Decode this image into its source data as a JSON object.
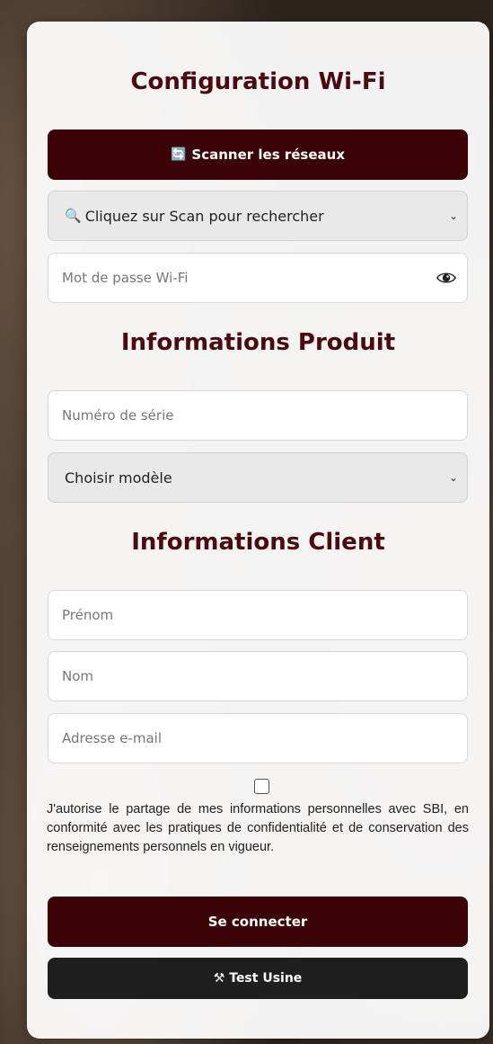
{
  "wifi": {
    "title": "Configuration Wi-Fi",
    "scan_icon": "🔄",
    "scan_label": "Scanner les réseaux",
    "network_icon": "🔍",
    "network_placeholder": "Cliquez sur Scan pour rechercher",
    "password_placeholder": "Mot de passe Wi-Fi"
  },
  "product": {
    "title": "Informations Produit",
    "serial_placeholder": "Numéro de série",
    "model_placeholder": "Choisir modèle"
  },
  "client": {
    "title": "Informations Client",
    "firstname_placeholder": "Prénom",
    "lastname_placeholder": "Nom",
    "email_placeholder": "Adresse e-mail",
    "consent_text": "J'autorise le partage de mes informations personnelles avec SBI, en conformité avec les pratiques de confidentialité et de conservation des renseignements personnels en vigueur."
  },
  "actions": {
    "connect_label": "Se connecter",
    "test_icon": "⚒",
    "test_label": "Test Usine"
  },
  "colors": {
    "accent": "#3c0307",
    "heading": "#4a0a10",
    "secondary_button": "#1f1f1f"
  }
}
